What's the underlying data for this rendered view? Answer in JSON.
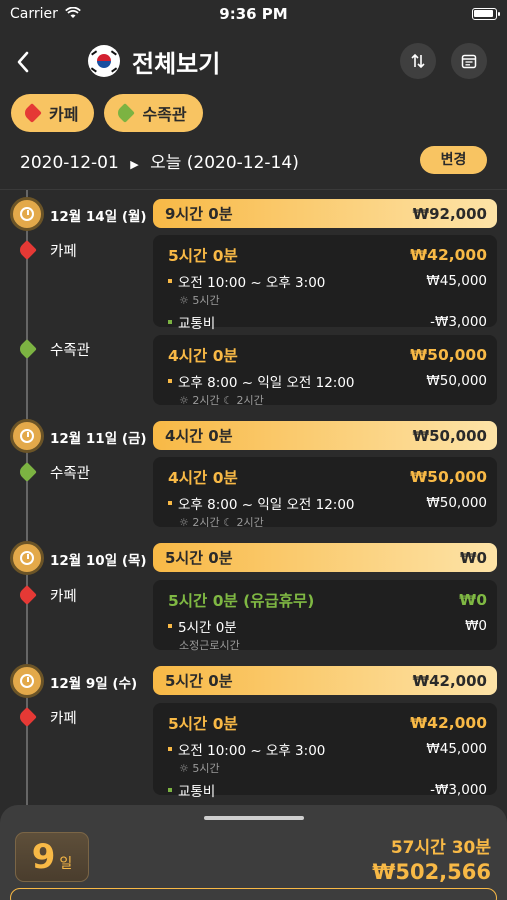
{
  "status": {
    "carrier": "Carrier",
    "time": "9:36 PM"
  },
  "nav": {
    "title": "전체보기"
  },
  "tags": [
    {
      "label": "카페",
      "color": "#e53935"
    },
    {
      "label": "수족관",
      "color": "#7cb342"
    }
  ],
  "range": {
    "from": "2020-12-01",
    "to": "오늘 (2020-12-14)",
    "change_label": "변경"
  },
  "days": [
    {
      "label": "12월 14일 (월)",
      "banner_time": "9시간 0분",
      "banner_pay": "₩92,000",
      "jobs": [
        {
          "name": "카페",
          "color": "#e53935",
          "head_time": "5시간 0분",
          "head_pay": "₩42,000",
          "rows": [
            {
              "text": "오전 10:00 ~ 오후 3:00",
              "value": "₩45,000",
              "sub": "☼ 5시간"
            },
            {
              "text": "교통비",
              "value": "-₩3,000"
            }
          ]
        },
        {
          "name": "수족관",
          "color": "#7cb342",
          "head_time": "4시간 0분",
          "head_pay": "₩50,000",
          "rows": [
            {
              "text": "오후 8:00 ~ 익일 오전 12:00",
              "value": "₩50,000",
              "sub": "☼ 2시간  ☾ 2시간"
            }
          ]
        }
      ]
    },
    {
      "label": "12월 11일 (금)",
      "banner_time": "4시간 0분",
      "banner_pay": "₩50,000",
      "jobs": [
        {
          "name": "수족관",
          "color": "#7cb342",
          "head_time": "4시간 0분",
          "head_pay": "₩50,000",
          "rows": [
            {
              "text": "오후 8:00 ~ 익일 오전 12:00",
              "value": "₩50,000",
              "sub": "☼ 2시간  ☾ 2시간"
            }
          ]
        }
      ]
    },
    {
      "label": "12월 10일 (목)",
      "banner_time": "5시간 0분",
      "banner_pay": "₩0",
      "jobs": [
        {
          "name": "카페",
          "color": "#e53935",
          "head_time": "5시간 0분 (유급휴무)",
          "head_pay": "₩0",
          "green": true,
          "rows": [
            {
              "text": "5시간 0분",
              "value": "₩0",
              "sub": "소정근로시간"
            }
          ]
        }
      ]
    },
    {
      "label": "12월 9일 (수)",
      "banner_time": "5시간 0분",
      "banner_pay": "₩42,000",
      "jobs": [
        {
          "name": "카페",
          "color": "#e53935",
          "head_time": "5시간 0분",
          "head_pay": "₩42,000",
          "rows": [
            {
              "text": "오전 10:00 ~ 오후 3:00",
              "value": "₩45,000",
              "sub": "☼ 5시간"
            },
            {
              "text": "교통비",
              "value": "-₩3,000"
            }
          ]
        }
      ]
    }
  ],
  "summary": {
    "days_count": "9",
    "days_unit": "일",
    "total_time": "57시간 30분",
    "total_pay": "₩502,566"
  },
  "colors": {
    "accent": "#f8b946",
    "red_tag": "#e53935",
    "green_tag": "#7cb342",
    "yellow_bullet": "#f8b946"
  }
}
